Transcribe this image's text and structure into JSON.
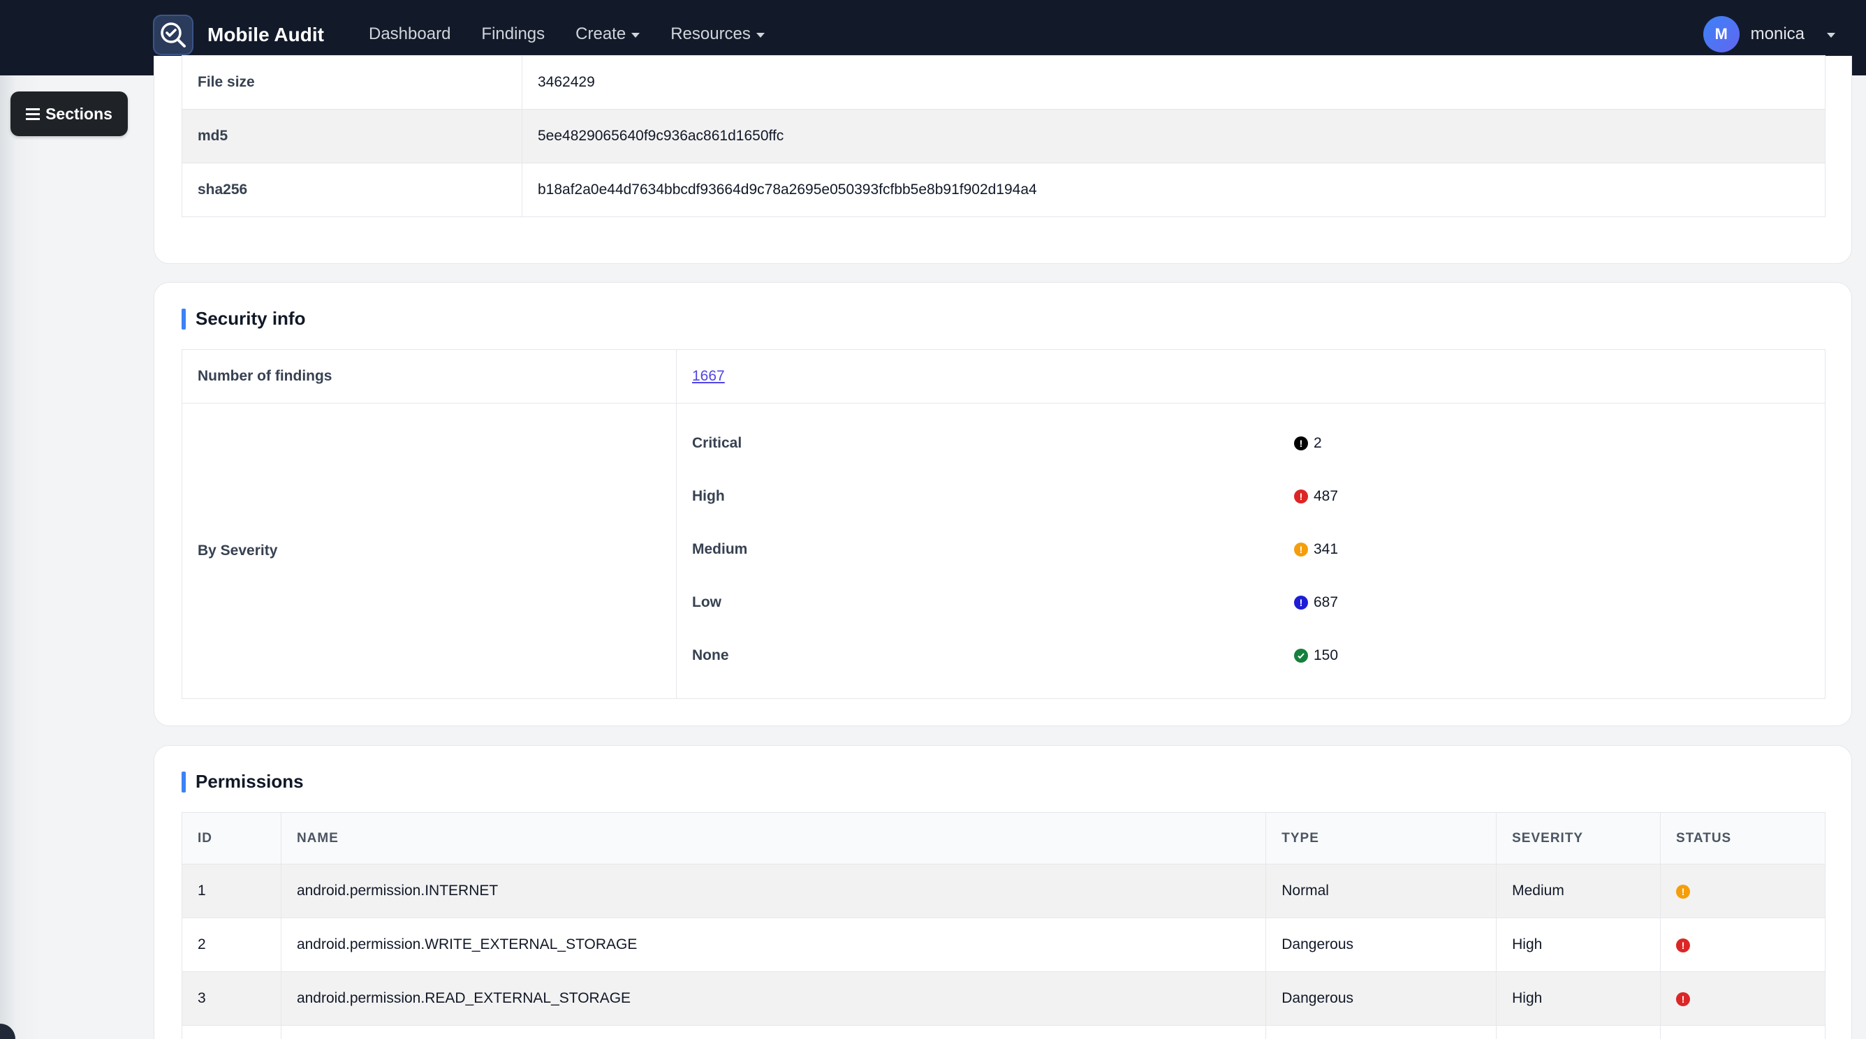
{
  "navbar": {
    "brand": "Mobile Audit",
    "links": [
      "Dashboard",
      "Findings",
      "Create",
      "Resources"
    ],
    "user": {
      "initial": "M",
      "name": "monica"
    }
  },
  "sidebar": {
    "sections_label": "Sections"
  },
  "file_info": {
    "rows": [
      {
        "label": "File size",
        "value": "3462429"
      },
      {
        "label": "md5",
        "value": "5ee4829065640f9c936ac861d1650ffc"
      },
      {
        "label": "sha256",
        "value": "b18af2a0e44d7634bbcdf93664d9c78a2695e050393fcfbb5e8b91f902d194a4"
      }
    ]
  },
  "security_info": {
    "title": "Security info",
    "findings_label": "Number of findings",
    "findings_value": "1667",
    "by_severity_label": "By Severity",
    "severities": [
      {
        "label": "Critical",
        "count": "2",
        "color": "#000000",
        "icon": "exclamation-circle-icon"
      },
      {
        "label": "High",
        "count": "487",
        "color": "#dc2626",
        "icon": "exclamation-circle-icon"
      },
      {
        "label": "Medium",
        "count": "341",
        "color": "#f59e0b",
        "icon": "exclamation-circle-icon"
      },
      {
        "label": "Low",
        "count": "687",
        "color": "#1d1dd6",
        "icon": "exclamation-circle-icon"
      },
      {
        "label": "None",
        "count": "150",
        "color": "#15803d",
        "icon": "check-circle-icon"
      }
    ]
  },
  "permissions": {
    "title": "Permissions",
    "columns": [
      "ID",
      "NAME",
      "TYPE",
      "SEVERITY",
      "STATUS"
    ],
    "rows": [
      {
        "id": "1",
        "name": "android.permission.INTERNET",
        "type": "Normal",
        "severity": "Medium",
        "status_color": "#f59e0b"
      },
      {
        "id": "2",
        "name": "android.permission.WRITE_EXTERNAL_STORAGE",
        "type": "Dangerous",
        "severity": "High",
        "status_color": "#dc2626"
      },
      {
        "id": "3",
        "name": "android.permission.READ_EXTERNAL_STORAGE",
        "type": "Dangerous",
        "severity": "High",
        "status_color": "#dc2626"
      },
      {
        "id": "",
        "name": "",
        "type": "",
        "severity": "",
        "status_color": ""
      }
    ]
  }
}
